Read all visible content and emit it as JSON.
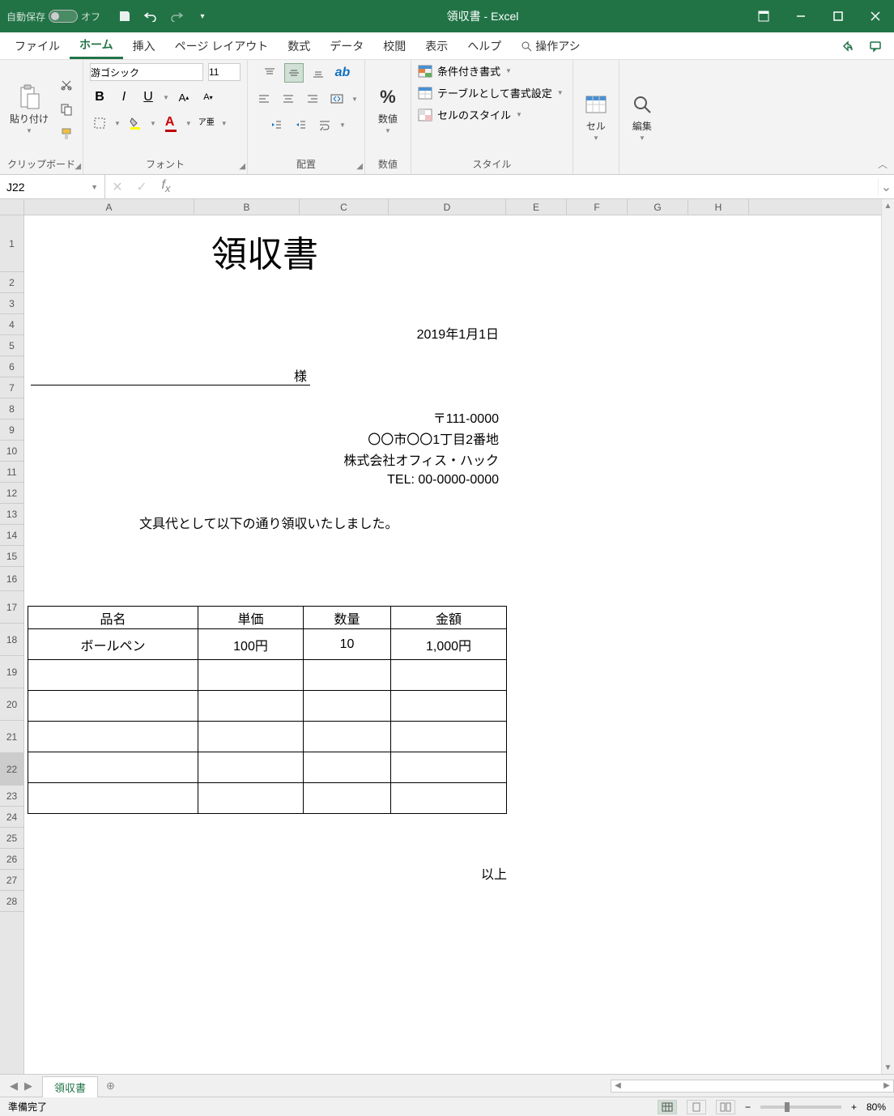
{
  "titlebar": {
    "autosave_label": "自動保存",
    "autosave_state": "オフ",
    "title": "領収書  -  Excel"
  },
  "menubar": {
    "tabs": [
      "ファイル",
      "ホーム",
      "挿入",
      "ページ レイアウト",
      "数式",
      "データ",
      "校閲",
      "表示",
      "ヘルプ"
    ],
    "search_label": "操作アシ"
  },
  "ribbon": {
    "clipboard": {
      "label": "クリップボード",
      "paste": "貼り付け"
    },
    "font": {
      "label": "フォント",
      "name": "游ゴシック",
      "size": "11",
      "ruby": "ア亜"
    },
    "alignment": {
      "label": "配置"
    },
    "number": {
      "label": "数値",
      "btn": "数値"
    },
    "styles": {
      "label": "スタイル",
      "cond": "条件付き書式",
      "table": "テーブルとして書式設定",
      "cell": "セルのスタイル"
    },
    "cells": {
      "label": "セル",
      "btn": "セル"
    },
    "editing": {
      "label": "編集",
      "btn": "編集"
    }
  },
  "formulabar": {
    "namebox": "J22",
    "formula": ""
  },
  "columns": [
    "A",
    "B",
    "C",
    "D",
    "E",
    "F",
    "G",
    "H"
  ],
  "doc": {
    "title": "領収書",
    "date": "2019年1月1日",
    "sama": "様",
    "post": "〒111-0000",
    "addr": "〇〇市〇〇1丁目2番地",
    "company": "株式会社オフィス・ハック",
    "tel": "TEL: 00-0000-0000",
    "note": "文具代として以下の通り領収いたしました。",
    "headers": [
      "品名",
      "単価",
      "数量",
      "金額"
    ],
    "row1": [
      "ボールペン",
      "100円",
      "10",
      "1,000円"
    ],
    "closing": "以上"
  },
  "sheettabs": {
    "sheet1": "領収書"
  },
  "statusbar": {
    "ready": "準備完了",
    "zoom": "80%"
  }
}
